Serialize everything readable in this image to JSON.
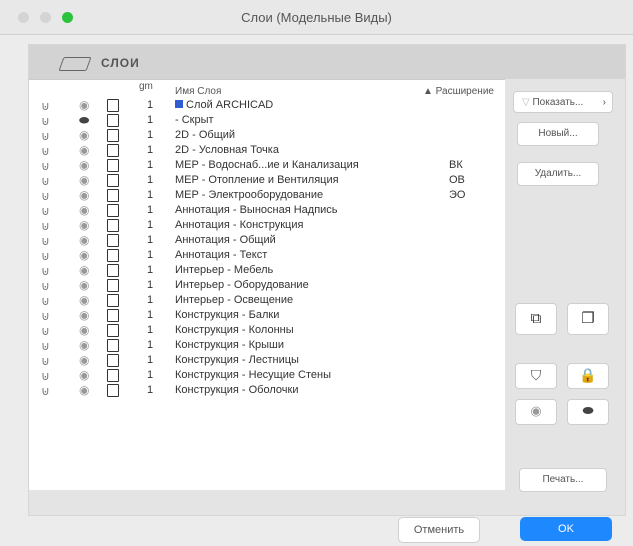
{
  "window": {
    "title": "Слои (Модельные Виды)"
  },
  "panel": {
    "title": "СЛОИ"
  },
  "list": {
    "headers": {
      "gm": "gm",
      "name": "Имя Слоя",
      "extension": "▲ Расширение"
    },
    "rows": [
      {
        "num": "1",
        "name": "Слой ARCHICAD",
        "ext": "",
        "eye": "open",
        "special": "archicad"
      },
      {
        "num": "1",
        "name": "- Скрыт",
        "ext": "",
        "eye": "closed"
      },
      {
        "num": "1",
        "name": "2D - Общий",
        "ext": "",
        "eye": "open"
      },
      {
        "num": "1",
        "name": "2D - Условная Точка",
        "ext": "",
        "eye": "open"
      },
      {
        "num": "1",
        "name": "MEP - Водоснаб...ие и Канализация",
        "ext": "ВК",
        "eye": "open"
      },
      {
        "num": "1",
        "name": "MEP - Отопление и Вентиляция",
        "ext": "ОВ",
        "eye": "open"
      },
      {
        "num": "1",
        "name": "MEP - Электрооборудование",
        "ext": "ЭО",
        "eye": "open"
      },
      {
        "num": "1",
        "name": "Аннотация - Выносная Надпись",
        "ext": "",
        "eye": "open"
      },
      {
        "num": "1",
        "name": "Аннотация - Конструкция",
        "ext": "",
        "eye": "open"
      },
      {
        "num": "1",
        "name": "Аннотация - Общий",
        "ext": "",
        "eye": "open"
      },
      {
        "num": "1",
        "name": "Аннотация - Текст",
        "ext": "",
        "eye": "open"
      },
      {
        "num": "1",
        "name": "Интерьер - Мебель",
        "ext": "",
        "eye": "open"
      },
      {
        "num": "1",
        "name": "Интерьер - Оборудование",
        "ext": "",
        "eye": "open"
      },
      {
        "num": "1",
        "name": "Интерьер - Освещение",
        "ext": "",
        "eye": "open"
      },
      {
        "num": "1",
        "name": "Конструкция - Балки",
        "ext": "",
        "eye": "open"
      },
      {
        "num": "1",
        "name": "Конструкция - Колонны",
        "ext": "",
        "eye": "open"
      },
      {
        "num": "1",
        "name": "Конструкция - Крыши",
        "ext": "",
        "eye": "open"
      },
      {
        "num": "1",
        "name": "Конструкция - Лестницы",
        "ext": "",
        "eye": "open"
      },
      {
        "num": "1",
        "name": "Конструкция - Несущие Стены",
        "ext": "",
        "eye": "open"
      },
      {
        "num": "1",
        "name": "Конструкция - Оболочки",
        "ext": "",
        "eye": "open"
      }
    ]
  },
  "sidebar": {
    "show": "Показать...",
    "new": "Новый...",
    "delete": "Удалить...",
    "print": "Печать..."
  },
  "footer": {
    "cancel": "Отменить",
    "ok": "OK"
  },
  "colors": {
    "accent": "#1e88ff"
  }
}
